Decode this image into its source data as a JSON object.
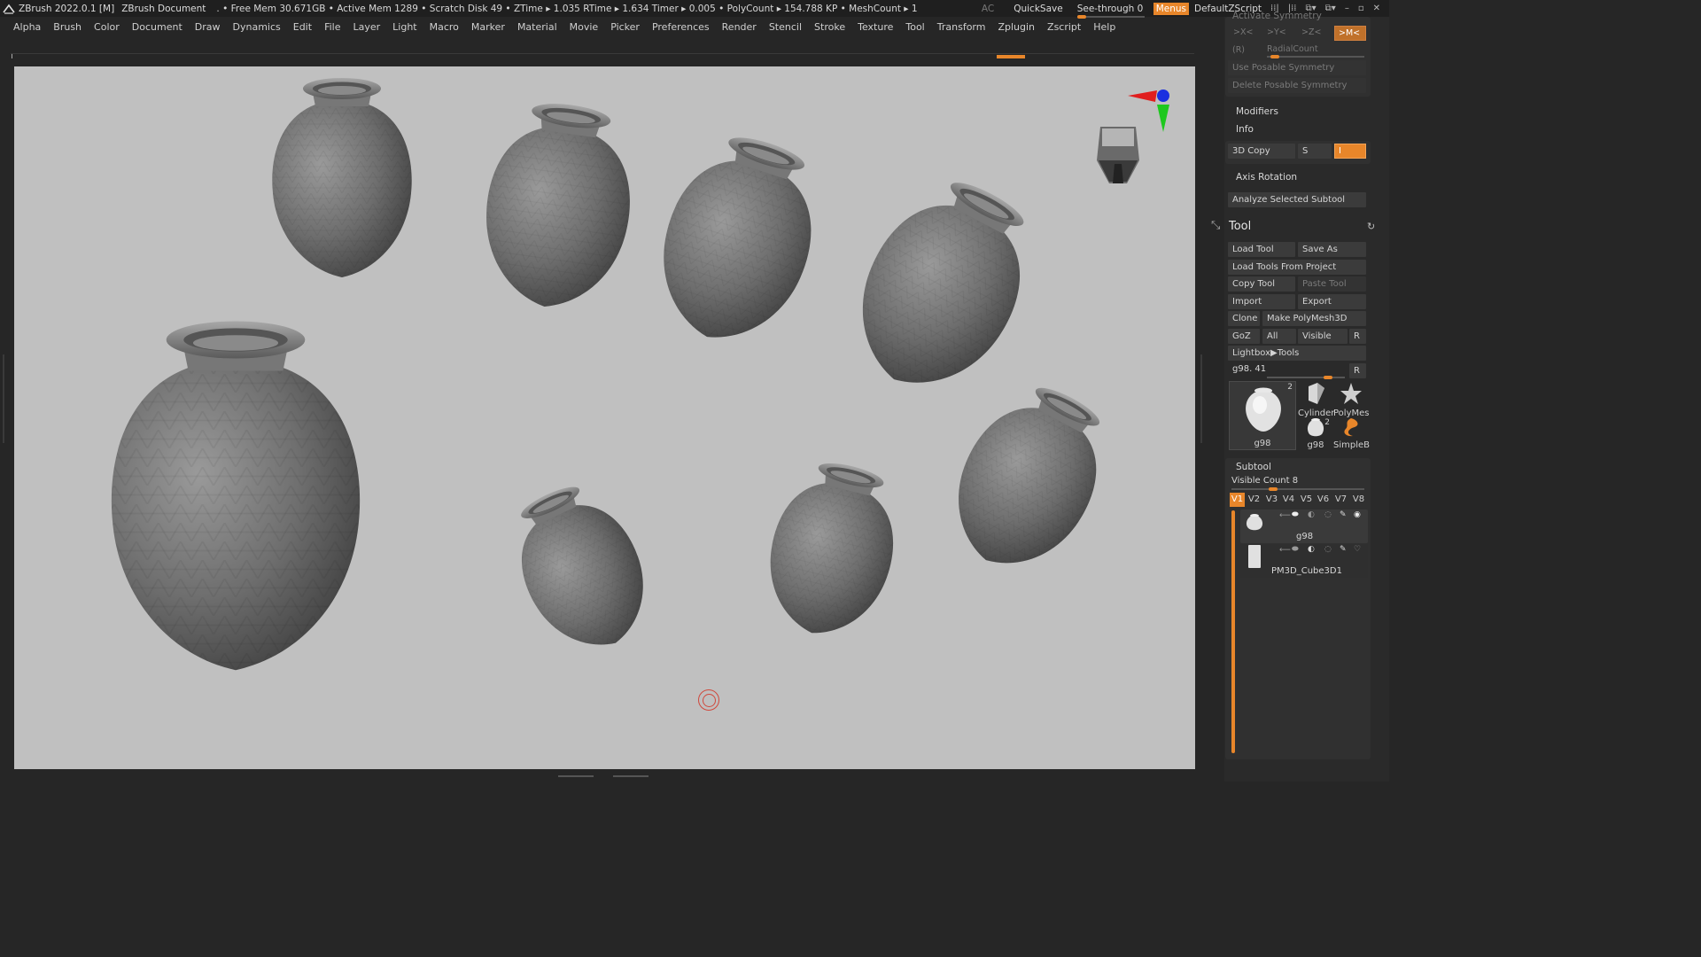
{
  "titlebar": {
    "app_title": "ZBrush 2022.0.1 [M]",
    "document": "ZBrush Document",
    "stats": ". • Free Mem 30.671GB • Active Mem 1289 • Scratch Disk 49 •  ZTime ▸ 1.035 RTime ▸ 1.634 Timer ▸ 0.005 • PolyCount ▸ 154.788 KP  • MeshCount ▸ 1",
    "ac": "AC",
    "quicksave": "QuickSave",
    "seethrough": "See-through  0",
    "menus": "Menus",
    "default_zscript": "DefaultZScript"
  },
  "menubar": {
    "items": [
      "Alpha",
      "Brush",
      "Color",
      "Document",
      "Draw",
      "Dynamics",
      "Edit",
      "File",
      "Layer",
      "Light",
      "Macro",
      "Marker",
      "Material",
      "Movie",
      "Picker",
      "Preferences",
      "Render",
      "Stencil",
      "Stroke",
      "Texture",
      "Tool",
      "Transform",
      "Zplugin",
      "Zscript",
      "Help"
    ]
  },
  "panel": {
    "activate_symmetry": "Activate Symmetry",
    "sym_x": ">X<",
    "sym_y": ">Y<",
    "sym_z": ">Z<",
    "sym_m": ">M<",
    "r_label": "(R)",
    "radial_count": "RadialCount",
    "use_posable": "Use Posable Symmetry",
    "delete_posable": "Delete Posable Symmetry",
    "modifiers": "Modifiers",
    "info": "Info",
    "copy3d": "3D Copy",
    "s_label": "S",
    "i_field": "I",
    "axis_rotation": "Axis Rotation",
    "analyze": "Analyze Selected Subtool",
    "tool_header": "Tool",
    "load_tool": "Load Tool",
    "save_as": "Save As",
    "load_from_project": "Load Tools From Project",
    "copy_tool": "Copy Tool",
    "paste_tool": "Paste Tool",
    "import": "Import",
    "export": "Export",
    "clone": "Clone",
    "make_polymesh": "Make PolyMesh3D",
    "goz": "GoZ",
    "all": "All",
    "visible": "Visible",
    "r_btn": "R",
    "lightbox_tools": "Lightbox▶Tools",
    "tool_name": "g98. 41",
    "thumb_main_caption": "g98",
    "thumb_main_count": "2",
    "thumb_cylinder": "Cylinder",
    "thumb_polymesh": "PolyMes",
    "thumb_small_caption": "g98",
    "thumb_small_count": "2",
    "thumb_simpleb": "SimpleB",
    "subtool_header": "Subtool",
    "visible_count": "Visible Count 8",
    "vtabs": [
      "V1",
      "V2",
      "V3",
      "V4",
      "V5",
      "V6",
      "V7",
      "V8"
    ],
    "subtool_1": "g98",
    "subtool_2": "PM3D_Cube3D1"
  },
  "colors": {
    "accent": "#e8862a",
    "viewport_bg": "#c0c0c0",
    "panel_bg": "#2a2a2a"
  }
}
